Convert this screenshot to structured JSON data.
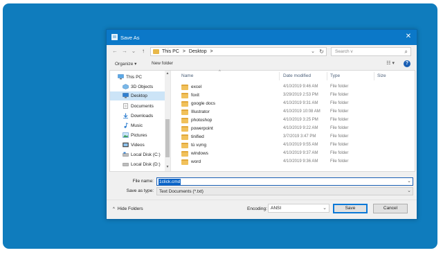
{
  "dialog": {
    "title": "Save As",
    "close": "✕"
  },
  "nav": {
    "back": "←",
    "forward": "→",
    "recent": "⌄",
    "up": "↑",
    "breadcrumb": [
      "This PC",
      ">",
      "Desktop",
      ">"
    ],
    "address_dropdown": "⌄",
    "refresh": "↻",
    "search_placeholder": "Search v",
    "search_icon": "⌕"
  },
  "toolbar": {
    "organize": "Organize ▾",
    "new_folder": "New folder",
    "view_icon": "☷ ▾",
    "help": "?"
  },
  "sidebar": {
    "items": [
      {
        "label": "This PC",
        "icon": "pc-icon"
      },
      {
        "label": "3D Objects",
        "icon": "cube-icon"
      },
      {
        "label": "Desktop",
        "icon": "desktop-icon",
        "selected": true
      },
      {
        "label": "Documents",
        "icon": "documents-icon"
      },
      {
        "label": "Downloads",
        "icon": "downloads-icon"
      },
      {
        "label": "Music",
        "icon": "music-icon"
      },
      {
        "label": "Pictures",
        "icon": "pictures-icon"
      },
      {
        "label": "Videos",
        "icon": "videos-icon"
      },
      {
        "label": "Local Disk (C:)",
        "icon": "drive-icon"
      },
      {
        "label": "Local Disk (D:)",
        "icon": "drive-icon"
      }
    ]
  },
  "columns": {
    "name": "Name",
    "date": "Date modified",
    "type": "Type",
    "size": "Size",
    "sort_arrow": "^"
  },
  "files": [
    {
      "name": "excel",
      "date": "4/10/2019 9:46 AM",
      "type": "File folder"
    },
    {
      "name": "foxit",
      "date": "3/29/2019 2:53 PM",
      "type": "File folder"
    },
    {
      "name": "google docs",
      "date": "4/10/2019 9:31 AM",
      "type": "File folder"
    },
    {
      "name": "Illustrator",
      "date": "4/10/2019 10:08 AM",
      "type": "File folder"
    },
    {
      "name": "photoshop",
      "date": "4/10/2019 3:25 PM",
      "type": "File folder"
    },
    {
      "name": "powerpoint",
      "date": "4/10/2019 9:22 AM",
      "type": "File folder"
    },
    {
      "name": "tinified",
      "date": "3/7/2019 3:47 PM",
      "type": "File folder"
    },
    {
      "name": "tù vựng",
      "date": "4/10/2019 9:55 AM",
      "type": "File folder"
    },
    {
      "name": "windows",
      "date": "4/10/2019 9:37 AM",
      "type": "File folder"
    },
    {
      "name": "word",
      "date": "4/10/2019 9:36 AM",
      "type": "File folder"
    }
  ],
  "form": {
    "filename_label": "File name:",
    "filename_value": "1click.cmd",
    "saveas_label": "Save as type:",
    "saveas_value": "Text Documents (*.txt)",
    "dropdown": "⌄"
  },
  "footer": {
    "hide_folders": "Hide Folders",
    "hide_chevron": "^",
    "encoding_label": "Encoding:",
    "encoding_value": "ANSI",
    "save": "Save",
    "cancel": "Cancel"
  },
  "colors": {
    "background_frame": "#0f7cbd",
    "titlebar": "#0b78c8",
    "selection": "#0a64c8",
    "folder": "#f1c15b"
  }
}
